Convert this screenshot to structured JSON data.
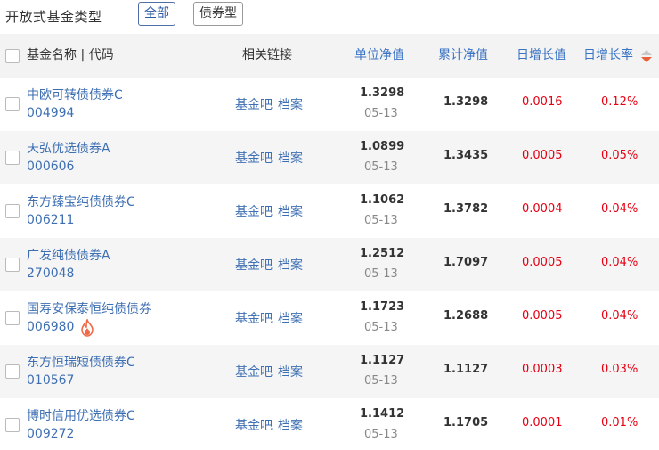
{
  "header": {
    "title": "开放式基金类型",
    "filters": [
      {
        "label": "全部"
      },
      {
        "label": "债券型"
      }
    ]
  },
  "table": {
    "columns": {
      "name": "基金名称 | 代码",
      "links": "相关链接",
      "unit_nav": "单位净值",
      "acc_nav": "累计净值",
      "daily_value": "日增长值",
      "daily_rate": "日增长率"
    },
    "sort_icon": "sort-desc-icon",
    "hot_icon": "hot-fire-icon",
    "colors": {
      "link": "#3e6fb3",
      "rise": "#e60012",
      "sort_accent": "#e8603c"
    },
    "rows": [
      {
        "name": "中欧可转债债券C",
        "code": "004994",
        "link_bar": "基金吧",
        "link_file": "档案",
        "unit_nav": "1.3298",
        "date": "05-13",
        "acc_nav": "1.3298",
        "daily_value": "0.0016",
        "daily_rate": "0.12%"
      },
      {
        "name": "天弘优选债券A",
        "code": "000606",
        "link_bar": "基金吧",
        "link_file": "档案",
        "unit_nav": "1.0899",
        "date": "05-13",
        "acc_nav": "1.3435",
        "daily_value": "0.0005",
        "daily_rate": "0.05%"
      },
      {
        "name": "东方臻宝纯债债券C",
        "code": "006211",
        "link_bar": "基金吧",
        "link_file": "档案",
        "unit_nav": "1.1062",
        "date": "05-13",
        "acc_nav": "1.3782",
        "daily_value": "0.0004",
        "daily_rate": "0.04%"
      },
      {
        "name": "广发纯债债券A",
        "code": "270048",
        "link_bar": "基金吧",
        "link_file": "档案",
        "unit_nav": "1.2512",
        "date": "05-13",
        "acc_nav": "1.7097",
        "daily_value": "0.0005",
        "daily_rate": "0.04%"
      },
      {
        "name": "国寿安保泰恒纯债债券",
        "code": "006980",
        "link_bar": "基金吧",
        "link_file": "档案",
        "unit_nav": "1.1723",
        "date": "05-13",
        "acc_nav": "1.2688",
        "daily_value": "0.0005",
        "daily_rate": "0.04%"
      },
      {
        "name": "东方恒瑞短债债券C",
        "code": "010567",
        "link_bar": "基金吧",
        "link_file": "档案",
        "unit_nav": "1.1127",
        "date": "05-13",
        "acc_nav": "1.1127",
        "daily_value": "0.0003",
        "daily_rate": "0.03%"
      },
      {
        "name": "博时信用优选债券C",
        "code": "009272",
        "link_bar": "基金吧",
        "link_file": "档案",
        "unit_nav": "1.1412",
        "date": "05-13",
        "acc_nav": "1.1705",
        "daily_value": "0.0001",
        "daily_rate": "0.01%"
      }
    ]
  }
}
